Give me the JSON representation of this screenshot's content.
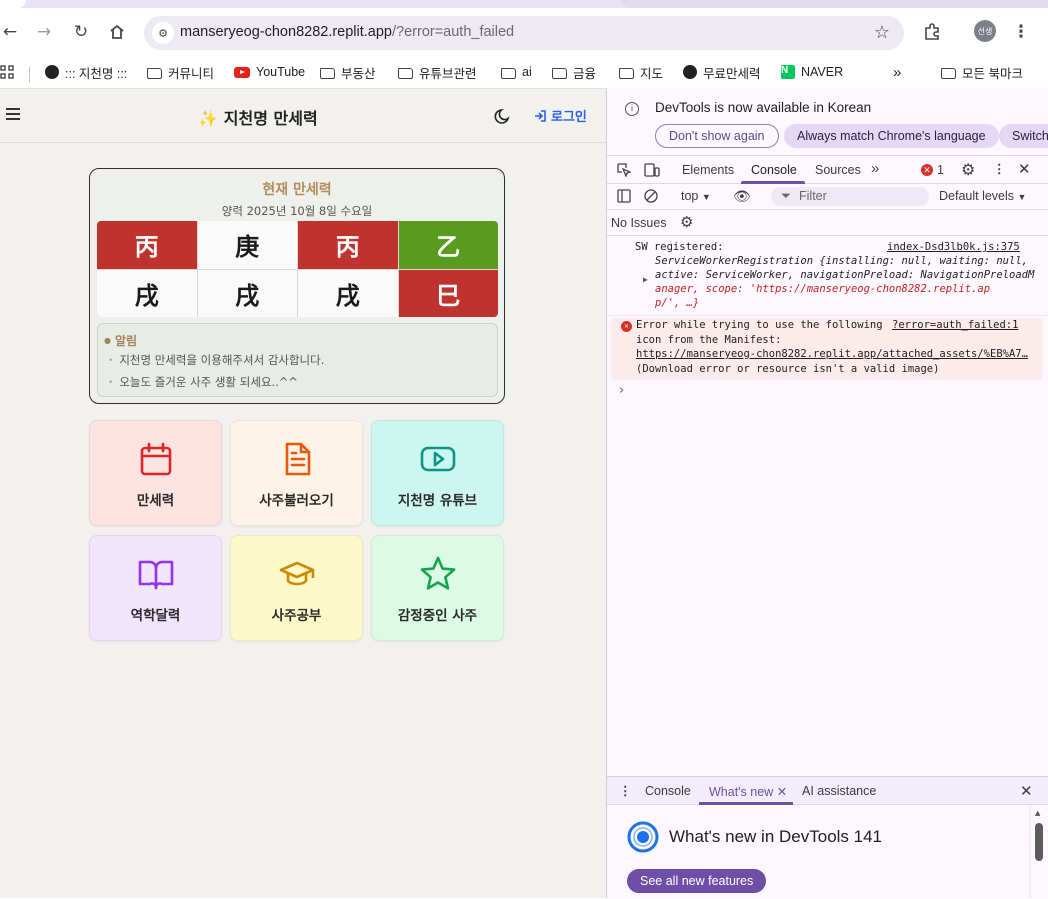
{
  "browser": {
    "url_host": "manseryeog-chon8282.replit.app",
    "url_path": "/?error=auth_failed",
    "profile_label": "선생"
  },
  "bookmarks": [
    {
      "label": "::: 지천명 :::",
      "icon": "globe-icon"
    },
    {
      "label": "커뮤니티",
      "icon": "folder-icon"
    },
    {
      "label": "YouTube",
      "icon": "youtube-icon"
    },
    {
      "label": "부동산",
      "icon": "folder-icon"
    },
    {
      "label": "유튜브관련",
      "icon": "folder-icon"
    },
    {
      "label": "ai",
      "icon": "folder-icon"
    },
    {
      "label": "금융",
      "icon": "folder-icon"
    },
    {
      "label": "지도",
      "icon": "folder-icon"
    },
    {
      "label": "무료만세력",
      "icon": "globe-icon"
    },
    {
      "label": "NAVER",
      "icon": "naver-icon"
    },
    {
      "label": "모든 북마크",
      "icon": "folder-icon"
    }
  ],
  "app": {
    "title": "지천명 만세력",
    "login_label": "로그인",
    "card": {
      "title": "현재 만세력",
      "date": "양력 2025년 10월 8일 수요일",
      "top_row": [
        "丙",
        "庚",
        "丙",
        "乙"
      ],
      "bottom_row": [
        "戌",
        "戌",
        "戌",
        "巳"
      ],
      "colors": {
        "red": "#c0322d",
        "green": "#5a9a1f",
        "white": "#fafafa"
      }
    },
    "notice": {
      "title": "알림",
      "lines": [
        "지천명 만세력을 이용해주셔서 감사합니다.",
        "오늘도 즐거운 사주 생활 되세요..^^"
      ]
    },
    "menu": [
      {
        "label": "만세력",
        "icon": "calendar-icon",
        "bg": "#fde2e2",
        "color": "#dc2626"
      },
      {
        "label": "사주불러오기",
        "icon": "document-icon",
        "bg": "#fdf3e7",
        "color": "#ea580c"
      },
      {
        "label": "지천명 유튜브",
        "icon": "youtube-play-icon",
        "bg": "#cdf7ee",
        "color": "#0d9488"
      },
      {
        "label": "역학달력",
        "icon": "book-icon",
        "bg": "#f1e4fd",
        "color": "#9333ea"
      },
      {
        "label": "사주공부",
        "icon": "graduation-cap-icon",
        "bg": "#fdf8c8",
        "color": "#ca8a04"
      },
      {
        "label": "감정중인 사주",
        "icon": "star-icon",
        "bg": "#dcfbe6",
        "color": "#16a34a"
      }
    ]
  },
  "devtools": {
    "info_text": "DevTools is now available in Korean",
    "info_buttons": [
      "Don't show again",
      "Always match Chrome's language",
      "Switch"
    ],
    "tabs": [
      "Elements",
      "Console",
      "Sources"
    ],
    "error_count": "1",
    "context": "top",
    "filter_placeholder": "Filter",
    "levels": "Default levels",
    "issues": "No Issues",
    "log1": {
      "text": "SW registered:",
      "source": "index-Dsd3lb0k.js:375",
      "line2": "ServiceWorkerRegistration {installing: null, waiting: null,",
      "line3": "active: ServiceWorker, navigationPreload: NavigationPreloadM",
      "line4": "anager, scope: 'https://manseryeog-chon8282.replit.ap",
      "line5": "p/', …}"
    },
    "log2": {
      "line1": "Error while trying to use the following",
      "source": "?error=auth_failed:1",
      "line2": "icon from the Manifest:",
      "line3": "https://manseryeog-chon8282.replit.app/attached_assets/%EB%A7…",
      "line4": "(Download error or resource isn't a valid image)"
    },
    "drawer_tabs": [
      "Console",
      "What's new",
      "AI assistance"
    ],
    "whats_new_title": "What's new in DevTools 141",
    "whats_new_button": "See all new features"
  }
}
